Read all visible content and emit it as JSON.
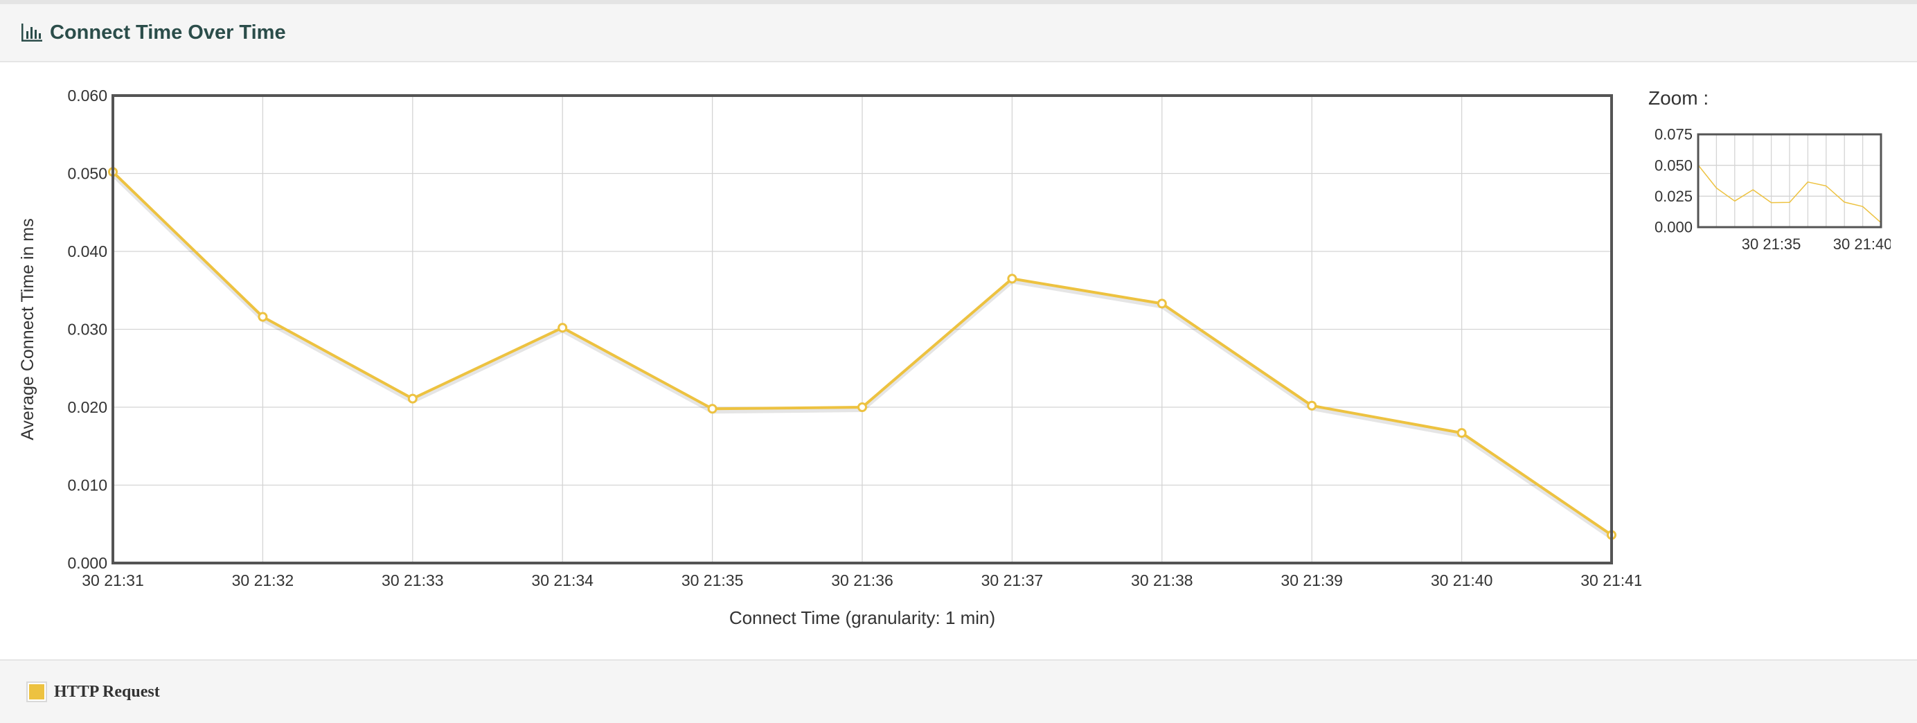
{
  "panel": {
    "title": "Connect Time Over Time",
    "icon": "bar-chart-icon"
  },
  "zoom": {
    "label": "Zoom :"
  },
  "legend": {
    "items": [
      {
        "label": "HTTP Request",
        "color": "#edc240"
      }
    ]
  },
  "chart_data": [
    {
      "type": "line",
      "x": [
        "30 21:31",
        "30 21:32",
        "30 21:33",
        "30 21:34",
        "30 21:35",
        "30 21:36",
        "30 21:37",
        "30 21:38",
        "30 21:39",
        "30 21:40",
        "30 21:41"
      ],
      "series": [
        {
          "name": "HTTP Request",
          "color": "#edc240",
          "values": [
            0.0502,
            0.0316,
            0.0211,
            0.0302,
            0.0198,
            0.02,
            0.0365,
            0.0333,
            0.0202,
            0.0167,
            0.0036
          ]
        }
      ],
      "xlabel": "Connect Time (granularity: 1 min)",
      "ylabel": "Average Connect Time in ms",
      "ylim": [
        0,
        0.06
      ],
      "yticks": [
        "0.000",
        "0.010",
        "0.020",
        "0.030",
        "0.040",
        "0.050",
        "0.060"
      ],
      "xticks": [
        "30 21:31",
        "30 21:32",
        "30 21:33",
        "30 21:34",
        "30 21:35",
        "30 21:36",
        "30 21:37",
        "30 21:38",
        "30 21:39",
        "30 21:40",
        "30 21:41"
      ],
      "grid": true,
      "markers": true
    },
    {
      "type": "line",
      "x": [
        "30 21:31",
        "30 21:32",
        "30 21:33",
        "30 21:34",
        "30 21:35",
        "30 21:36",
        "30 21:37",
        "30 21:38",
        "30 21:39",
        "30 21:40",
        "30 21:41"
      ],
      "series": [
        {
          "name": "HTTP Request",
          "color": "#edc240",
          "values": [
            0.0502,
            0.0316,
            0.0211,
            0.0302,
            0.0198,
            0.02,
            0.0365,
            0.0333,
            0.0202,
            0.0167,
            0.0036
          ]
        }
      ],
      "ylim": [
        0,
        0.075
      ],
      "yticks": [
        "0.000",
        "0.025",
        "0.050",
        "0.075"
      ],
      "xticks": [
        "30 21:35",
        "30 21:40"
      ],
      "grid": true,
      "markers": false
    }
  ]
}
